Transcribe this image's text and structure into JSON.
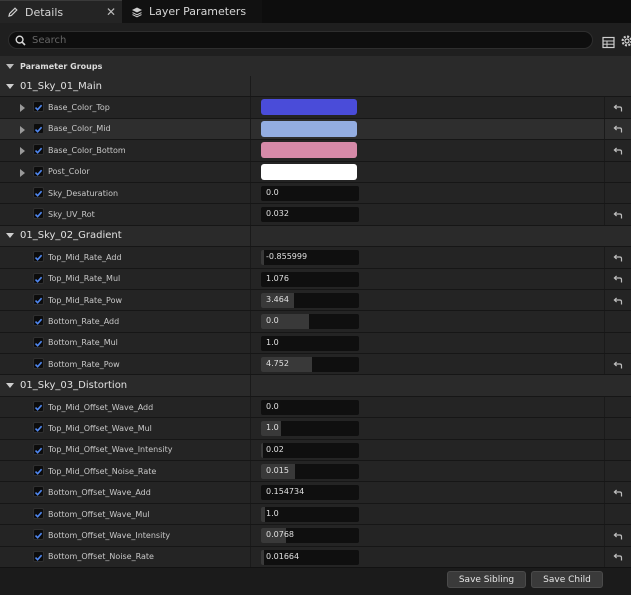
{
  "tabs": [
    {
      "label": "Details",
      "icon": "pencil-icon",
      "active": true
    },
    {
      "label": "Layer Parameters",
      "icon": "layers-icon",
      "active": false
    }
  ],
  "search": {
    "placeholder": "Search"
  },
  "groups_header": "Parameter Groups",
  "sections": [
    {
      "label": "01_Sky_01_Main",
      "params": [
        {
          "name": "Base_Color_Top",
          "kind": "color",
          "color": "#4a4cd9",
          "expandable": true,
          "reset": true
        },
        {
          "name": "Base_Color_Mid",
          "kind": "color",
          "color": "#93ade1",
          "expandable": true,
          "reset": true,
          "highlight": true
        },
        {
          "name": "Base_Color_Bottom",
          "kind": "color",
          "color": "#d68aa8",
          "expandable": true,
          "reset": true
        },
        {
          "name": "Post_Color",
          "kind": "color",
          "color": "#ffffff",
          "expandable": true,
          "reset": false
        },
        {
          "name": "Sky_Desaturation",
          "kind": "scalar",
          "value": "0.0",
          "fill": 0.0,
          "reset": false
        },
        {
          "name": "Sky_UV_Rot",
          "kind": "scalar",
          "value": "0.032",
          "fill": 0.0,
          "reset": true
        }
      ]
    },
    {
      "label": "01_Sky_02_Gradient",
      "params": [
        {
          "name": "Top_Mid_Rate_Add",
          "kind": "scalar",
          "value": "-0.855999",
          "fill": 0.03,
          "reset": true
        },
        {
          "name": "Top_Mid_Rate_Mul",
          "kind": "scalar",
          "value": "1.076",
          "fill": 0.0,
          "reset": true
        },
        {
          "name": "Top_Mid_Rate_Pow",
          "kind": "scalar",
          "value": "3.464",
          "fill": 0.34,
          "reset": true
        },
        {
          "name": "Bottom_Rate_Add",
          "kind": "scalar",
          "value": "0.0",
          "fill": 0.49,
          "reset": false
        },
        {
          "name": "Bottom_Rate_Mul",
          "kind": "scalar",
          "value": "1.0",
          "fill": 0.0,
          "reset": false
        },
        {
          "name": "Bottom_Rate_Pow",
          "kind": "scalar",
          "value": "4.752",
          "fill": 0.52,
          "reset": true
        }
      ]
    },
    {
      "label": "01_Sky_03_Distortion",
      "params": [
        {
          "name": "Top_Mid_Offset_Wave_Add",
          "kind": "scalar",
          "value": "0.0",
          "fill": 0.0,
          "reset": false
        },
        {
          "name": "Top_Mid_Offset_Wave_Mul",
          "kind": "scalar",
          "value": "1.0",
          "fill": 0.2,
          "reset": false
        },
        {
          "name": "Top_Mid_Offset_Wave_Intensity",
          "kind": "scalar",
          "value": "0.02",
          "fill": 0.02,
          "reset": false
        },
        {
          "name": "Top_Mid_Offset_Noise_Rate",
          "kind": "scalar",
          "value": "0.015",
          "fill": 0.35,
          "reset": false
        },
        {
          "name": "Bottom_Offset_Wave_Add",
          "kind": "scalar",
          "value": "0.154734",
          "fill": 0.0,
          "reset": true
        },
        {
          "name": "Bottom_Offset_Wave_Mul",
          "kind": "scalar",
          "value": "1.0",
          "fill": 0.04,
          "reset": false
        },
        {
          "name": "Bottom_Offset_Wave_Intensity",
          "kind": "scalar",
          "value": "0.0768",
          "fill": 0.25,
          "reset": true
        },
        {
          "name": "Bottom_Offset_Noise_Rate",
          "kind": "scalar",
          "value": "0.01664",
          "fill": 0.03,
          "reset": true
        }
      ]
    }
  ],
  "buttons": {
    "save_sibling": "Save Sibling",
    "save_child": "Save Child"
  },
  "colors": {
    "accent_check": "#2f6fe0",
    "panel": "#242424",
    "header": "#2a2a2a"
  }
}
